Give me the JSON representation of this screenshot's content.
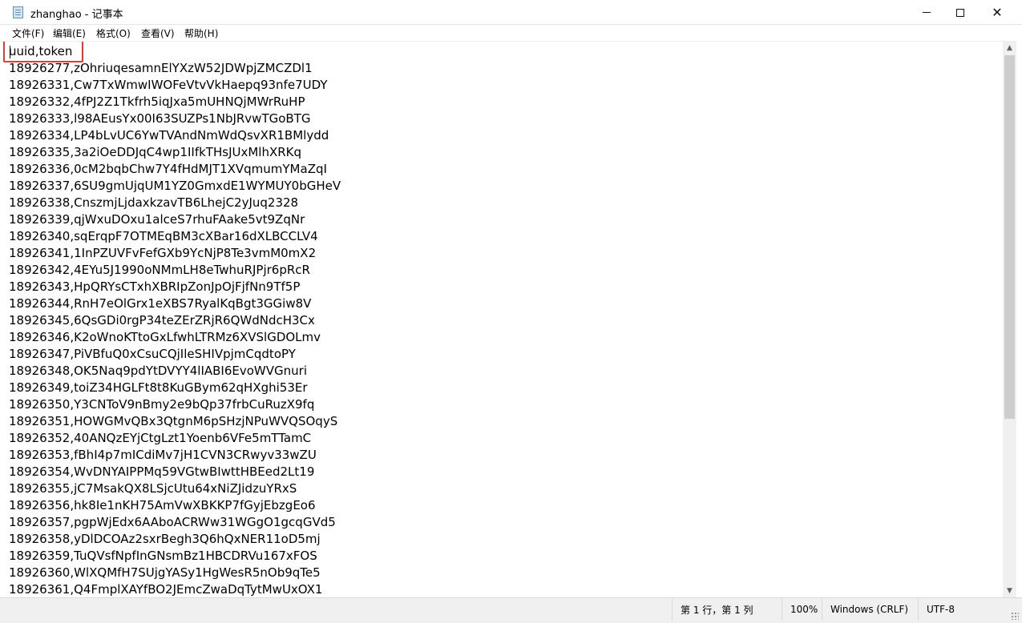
{
  "window": {
    "title": "zhanghao - 记事本",
    "icon": "notepad-icon"
  },
  "window_controls": {
    "minimize_icon": "minimize-icon",
    "maximize_icon": "maximize-icon",
    "close_icon": "close-icon"
  },
  "menu": {
    "items": [
      {
        "label": "文件(F)"
      },
      {
        "label": "编辑(E)"
      },
      {
        "label": "格式(O)"
      },
      {
        "label": "查看(V)"
      },
      {
        "label": "帮助(H)"
      }
    ]
  },
  "editor": {
    "lines": [
      "uuid,token",
      "18926277,zOhriuqesamnElYXzW52JDWpjZMCZDl1",
      "18926331,Cw7TxWmwIWOFeVtvVkHaepq93nfe7UDY",
      "18926332,4fPJ2Z1Tkfrh5iqJxa5mUHNQjMWrRuHP",
      "18926333,l98AEusYx00I63SUZPs1NbJRvwTGoBTG",
      "18926334,LP4bLvUC6YwTVAndNmWdQsvXR1BMlydd",
      "18926335,3a2iOeDDJqC4wp1IIfkTHsJUxMlhXRKq",
      "18926336,0cM2bqbChw7Y4fHdMJT1XVqmumYMaZqI",
      "18926337,6SU9gmUjqUM1YZ0GmxdE1WYMUY0bGHeV",
      "18926338,CnszmjLjdaxkzavTB6LhejC2yJuq2328",
      "18926339,qjWxuDOxu1alceS7rhuFAake5vt9ZqNr",
      "18926340,sqErqpF7OTMEqBM3cXBar16dXLBCCLV4",
      "18926341,1InPZUVFvFefGXb9YcNjP8Te3vmM0mX2",
      "18926342,4EYu5J1990oNMmLH8eTwhuRJPjr6pRcR",
      "18926343,HpQRYsCTxhXBRIpZonJpOjFjfNn9Tf5P",
      "18926344,RnH7eOlGrx1eXBS7RyalKqBgt3GGiw8V",
      "18926345,6QsGDi0rgP34teZErZRjR6QWdNdcH3Cx",
      "18926346,K2oWnoKTtoGxLfwhLTRMz6XVSlGDOLmv",
      "18926347,PiVBfuQ0xCsuCQjIleSHIVpjmCqdtoPY",
      "18926348,OK5Naq9pdYtDVYY4lIABI6EvoWVGnuri",
      "18926349,toiZ34HGLFt8t8KuGBym62qHXghi53Er",
      "18926350,Y3CNToV9nBmy2e9bQp37frbCuRuzX9fq",
      "18926351,HOWGMvQBx3QtgnM6pSHzjNPuWVQSOqyS",
      "18926352,40ANQzEYjCtgLzt1Yoenb6VFe5mTTamC",
      "18926353,fBhI4p7mICdiMv7jH1CVN3CRwyv33wZU",
      "18926354,WvDNYAIPPMq59VGtwBIwttHBEed2Lt19",
      "18926355,jC7MsakQX8LSjcUtu64xNiZJidzuYRxS",
      "18926356,hk8Ie1nKH75AmVwXBKKP7fGyjEbzgEo6",
      "18926357,pgpWjEdx6AAboACRWw31WGgO1gcqGVd5",
      "18926358,yDlDCOAz2sxrBegh3Q6hQxNER11oD5mj",
      "18926359,TuQVsfNpfInGNsmBz1HBCDRVu167xFOS",
      "18926360,WlXQMfH7SUjgYASy1HgWesR5nOb9qTe5",
      "18926361,Q4FmplXAYfBO2JEmcZwaDqTytMwUxOX1"
    ],
    "highlight_color": "#e53935"
  },
  "scrollbar": {
    "up_icon": "scroll-up-icon",
    "down_icon": "scroll-down-icon"
  },
  "statusbar": {
    "position": "第 1 行，第 1 列",
    "zoom": "100%",
    "line_ending": "Windows (CRLF)",
    "encoding": "UTF-8"
  }
}
